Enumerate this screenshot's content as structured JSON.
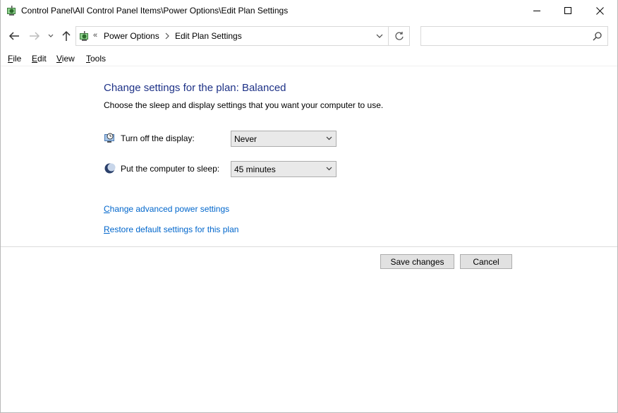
{
  "window": {
    "title": "Control Panel\\All Control Panel Items\\Power Options\\Edit Plan Settings"
  },
  "address": {
    "overflow_chevron": "«",
    "crumbs": [
      "Power Options",
      "Edit Plan Settings"
    ]
  },
  "search": {
    "placeholder": ""
  },
  "menu": {
    "file": {
      "u": "F",
      "rest": "ile"
    },
    "edit": {
      "u": "E",
      "rest": "dit"
    },
    "view": {
      "u": "V",
      "rest": "iew"
    },
    "tools": {
      "u": "T",
      "rest": "ools"
    }
  },
  "content": {
    "heading": "Change settings for the plan: Balanced",
    "subheading": "Choose the sleep and display settings that you want your computer to use.",
    "display": {
      "label": "Turn off the display:",
      "value": "Never"
    },
    "sleep": {
      "label": "Put the computer to sleep:",
      "value": "45 minutes"
    },
    "link_advanced": {
      "u": "C",
      "rest": "hange advanced power settings"
    },
    "link_restore": {
      "u": "R",
      "rest": "estore default settings for this plan"
    }
  },
  "buttons": {
    "save": "Save changes",
    "cancel": "Cancel"
  },
  "colors": {
    "heading": "#1e3287",
    "link": "#0066cc"
  }
}
